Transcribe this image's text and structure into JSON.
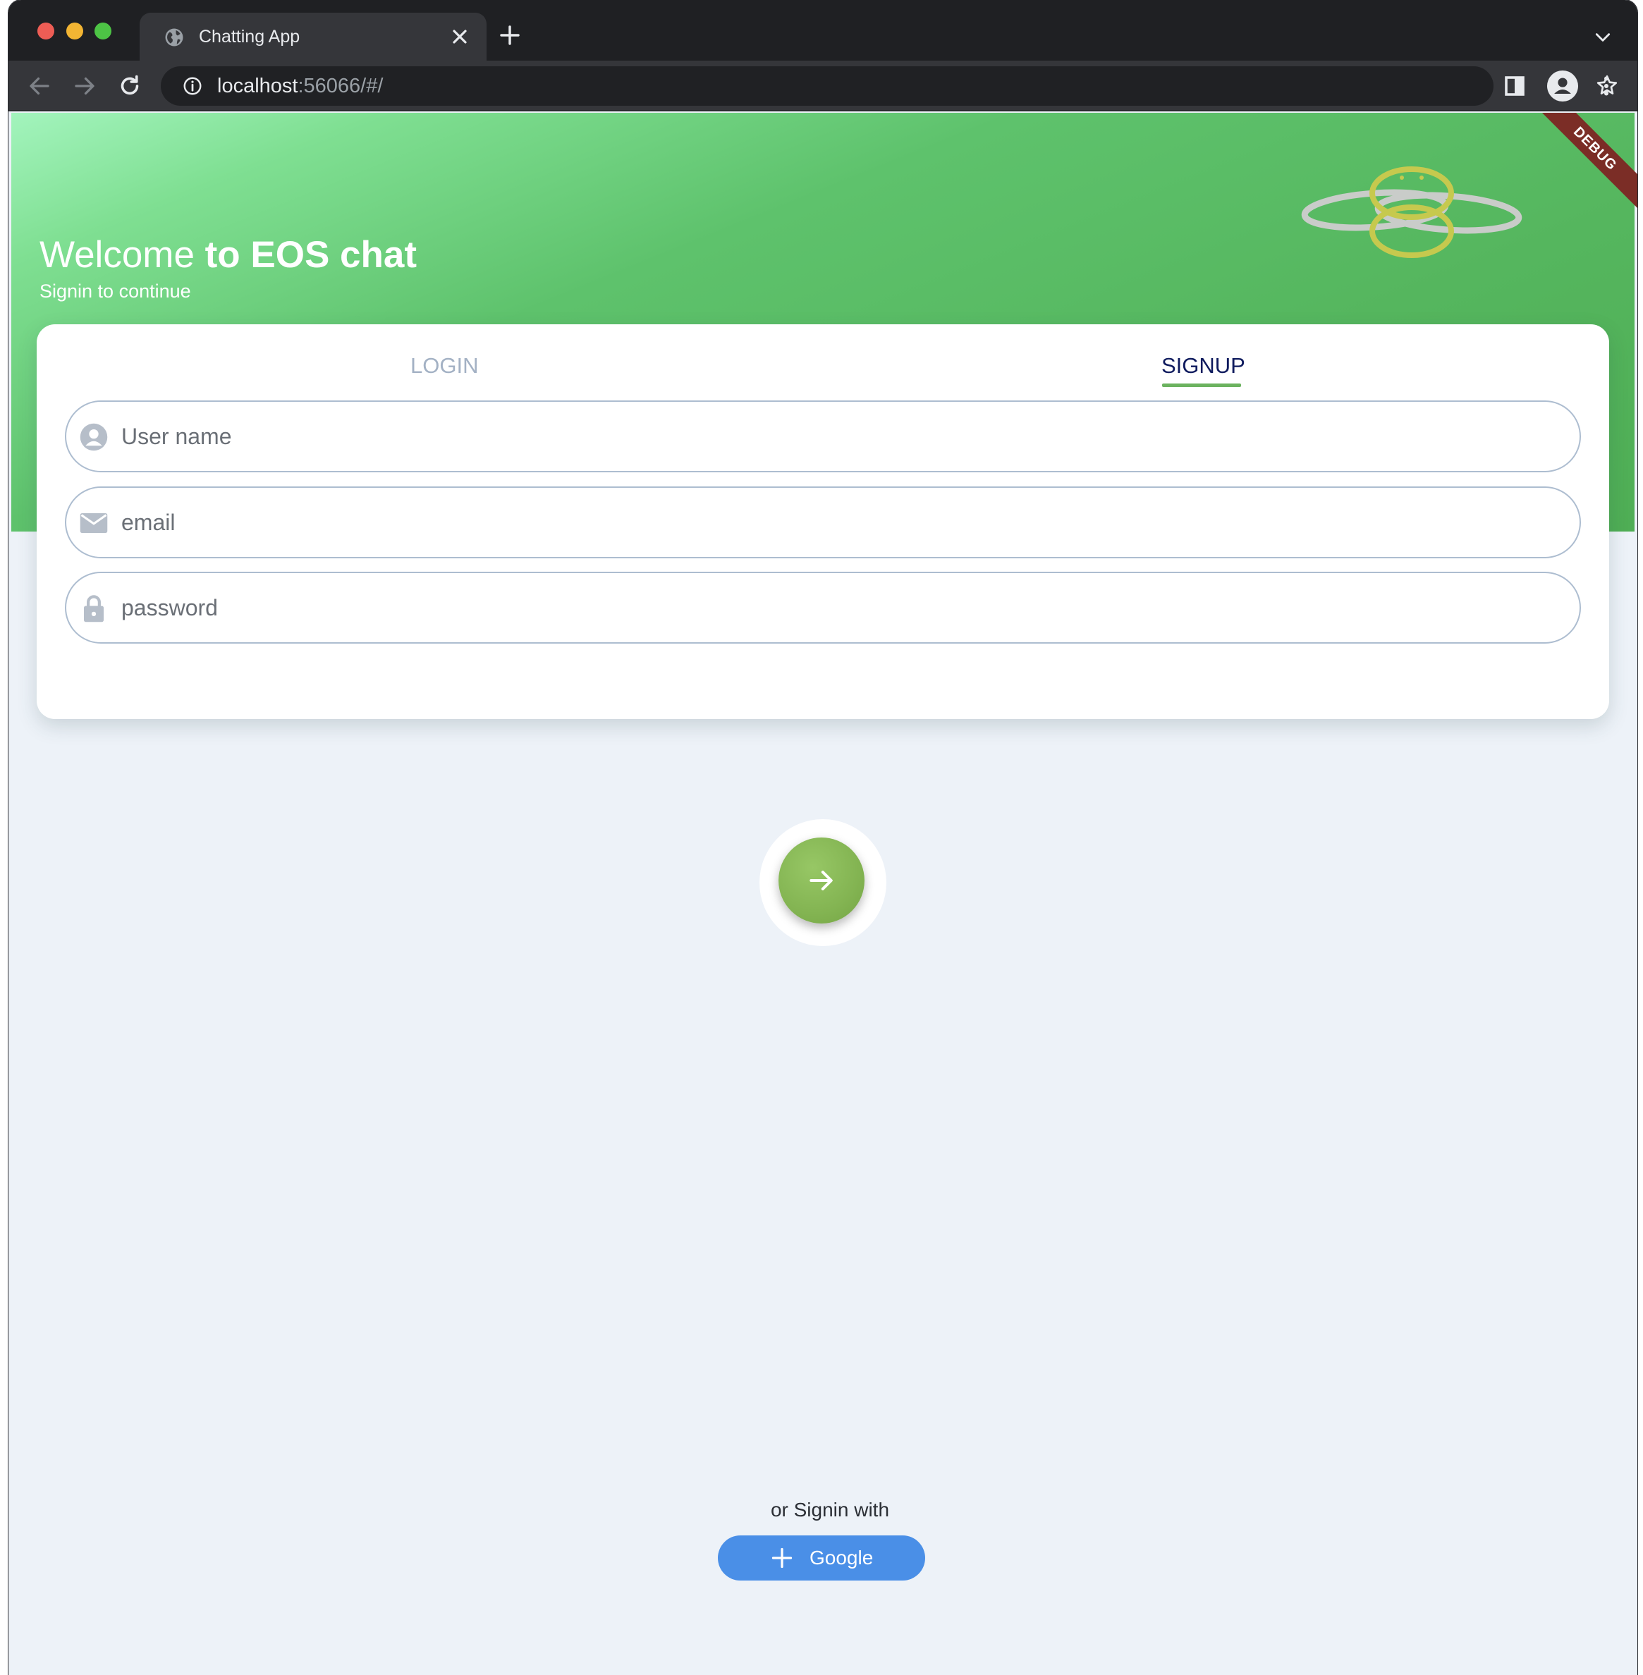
{
  "browser": {
    "tab_title": "Chatting App",
    "url_host": "localhost",
    "url_rest": ":56066/#/",
    "icons": [
      "globe-icon",
      "close-icon",
      "plus-icon",
      "chevron-down-icon",
      "back-arrow-icon",
      "forward-arrow-icon",
      "reload-icon",
      "info-icon",
      "share-icon",
      "star-icon",
      "side-panel-icon",
      "profile-icon",
      "kebab-menu-icon"
    ]
  },
  "hero": {
    "welcome_prefix": "Welcome ",
    "welcome_bold": "to EOS chat",
    "subtitle": "Signin to continue",
    "debug_banner": "DEBUG",
    "gradient_colors": [
      "#a3f4bd",
      "#5ec26c",
      "#4fae55"
    ]
  },
  "auth": {
    "tabs": {
      "login": "LOGIN",
      "signup": "SIGNUP",
      "active": "SIGNUP"
    },
    "fields": {
      "username": {
        "placeholder": "User name",
        "value": ""
      },
      "email": {
        "placeholder": "email",
        "value": ""
      },
      "password": {
        "placeholder": "password",
        "value": ""
      }
    },
    "submit_icon": "arrow-right-icon",
    "accent_color": "#6bb25f",
    "active_tab_color": "#0f1b5e"
  },
  "social": {
    "prompt": "or Signin with",
    "google_label": "Google",
    "google_color": "#4a8fe7"
  }
}
